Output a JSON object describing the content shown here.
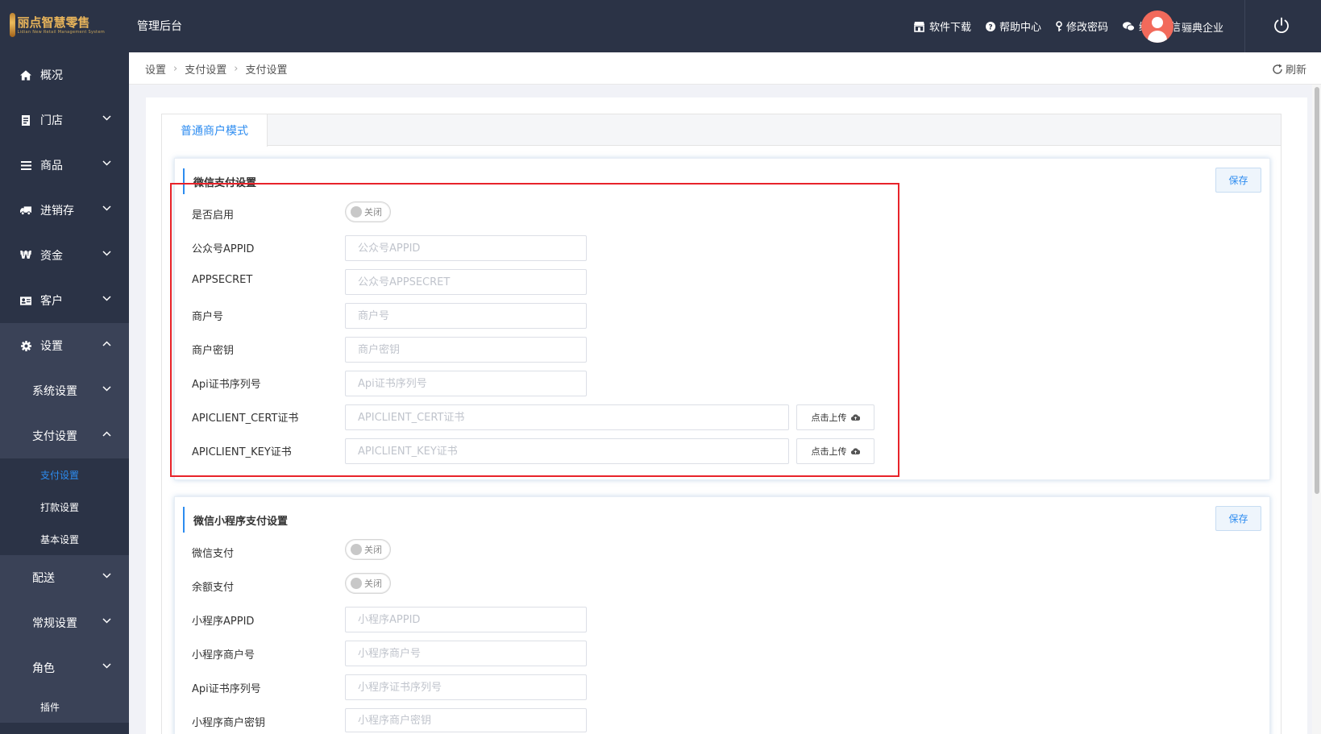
{
  "header": {
    "logo_title": "丽点智慧零售",
    "logo_sub": "Lidian New Retail Management System",
    "admin_title": "管理后台",
    "nav": [
      {
        "label": "软件下载",
        "icon": "store-icon"
      },
      {
        "label": "帮助中心",
        "icon": "help-icon"
      },
      {
        "label": "修改密码",
        "icon": "key-icon"
      },
      {
        "label": "绑定微信",
        "icon": "wechat-icon"
      }
    ],
    "username": "骊典企业"
  },
  "sidebar": {
    "items": [
      {
        "label": "概况",
        "icon": "home-icon"
      },
      {
        "label": "门店",
        "icon": "store-doc-icon"
      },
      {
        "label": "商品",
        "icon": "list-icon"
      },
      {
        "label": "进销存",
        "icon": "truck-icon"
      },
      {
        "label": "资金",
        "icon": "won-icon"
      },
      {
        "label": "客户",
        "icon": "id-card-icon"
      },
      {
        "label": "设置",
        "icon": "gear-icon"
      }
    ],
    "sub": [
      {
        "label": "系统设置"
      },
      {
        "label": "支付设置"
      }
    ],
    "leaves": [
      {
        "label": "支付设置"
      },
      {
        "label": "打款设置"
      },
      {
        "label": "基本设置"
      }
    ],
    "bottom": [
      {
        "label": "配送"
      },
      {
        "label": "常规设置"
      },
      {
        "label": "角色"
      }
    ],
    "plugin": "插件"
  },
  "breadcrumb": {
    "items": [
      "设置",
      "支付设置",
      "支付设置"
    ],
    "refresh": "刷新"
  },
  "tab": {
    "label": "普通商户模式"
  },
  "wechat_card": {
    "title": "微信支付设置",
    "save": "保存",
    "enable_label": "是否启用",
    "enable_state": "关闭",
    "fields": [
      {
        "label": "公众号APPID",
        "placeholder": "公众号APPID"
      },
      {
        "label": "APPSECRET",
        "placeholder": "公众号APPSECRET"
      },
      {
        "label": "商户号",
        "placeholder": "商户号"
      },
      {
        "label": "商户密钥",
        "placeholder": "商户密钥"
      },
      {
        "label": "Api证书序列号",
        "placeholder": "Api证书序列号"
      }
    ],
    "cert_fields": [
      {
        "label": "APICLIENT_CERT证书",
        "placeholder": "APICLIENT_CERT证书",
        "button": "点击上传"
      },
      {
        "label": "APICLIENT_KEY证书",
        "placeholder": "APICLIENT_KEY证书",
        "button": "点击上传"
      }
    ]
  },
  "mini_card": {
    "title": "微信小程序支付设置",
    "save": "保存",
    "toggles": [
      {
        "label": "微信支付",
        "state": "关闭"
      },
      {
        "label": "余额支付",
        "state": "关闭"
      }
    ],
    "fields": [
      {
        "label": "小程序APPID",
        "placeholder": "小程序APPID"
      },
      {
        "label": "小程序商户号",
        "placeholder": "小程序商户号"
      },
      {
        "label": "Api证书序列号",
        "placeholder": "小程序证书序列号"
      },
      {
        "label": "小程序商户密钥",
        "placeholder": "小程序商户密钥"
      }
    ]
  },
  "colors": {
    "topbar": "#2b3346",
    "accent": "#2d8cf0",
    "highlight_box": "#e8232a",
    "avatar": "#f26a5b"
  }
}
